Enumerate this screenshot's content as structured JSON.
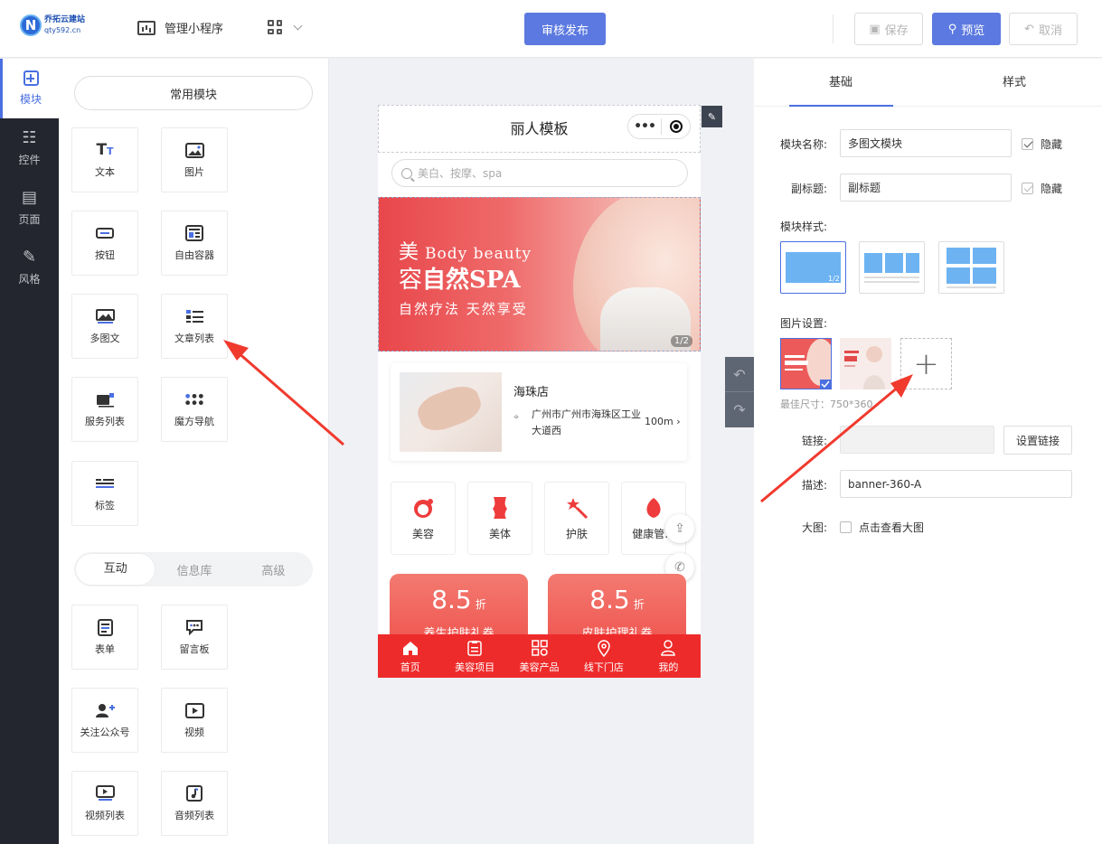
{
  "brand": {
    "line1": "乔拓云建站",
    "line2": "qty592.cn"
  },
  "topbar": {
    "manage_label": "管理小程序",
    "publish_label": "审核发布",
    "save_label": "保存",
    "preview_label": "预览",
    "cancel_label": "取消"
  },
  "leftnav": [
    {
      "label": "模块",
      "icon": "plus-square-icon",
      "active": true
    },
    {
      "label": "控件",
      "icon": "sliders-icon"
    },
    {
      "label": "页面",
      "icon": "pages-icon"
    },
    {
      "label": "风格",
      "icon": "magic-wand-icon"
    }
  ],
  "modules": {
    "common_label": "常用模块",
    "items": [
      "文本",
      "图片",
      "按钮",
      "自由容器",
      "多图文",
      "文章列表",
      "服务列表",
      "魔方导航",
      "标签"
    ],
    "tabs": [
      "互动",
      "信息库",
      "高级"
    ],
    "interactive": [
      "表单",
      "留言板",
      "关注公众号",
      "视频",
      "视频列表",
      "音频列表"
    ]
  },
  "phone": {
    "title": "丽人模板",
    "search_placeholder": "美白、按摩、spa",
    "banner": {
      "line1_a": "美",
      "line1_b": "Body beauty",
      "line2_a": "容",
      "line2_b": "自然SPA",
      "line3": "自然疗法 天然享受",
      "pager": "1/2"
    },
    "store": {
      "name": "海珠店",
      "address": "广州市广州市海珠区工业大道西",
      "distance": "100m"
    },
    "categories": [
      "美容",
      "美体",
      "护肤",
      "健康管..."
    ],
    "coupons": [
      {
        "value": "8.5",
        "unit": "折",
        "desc": "养生护肤礼券"
      },
      {
        "value": "8.5",
        "unit": "折",
        "desc": "皮肤护理礼券"
      }
    ],
    "tabbar": [
      "首页",
      "美容项目",
      "美容产品",
      "线下门店",
      "我的"
    ]
  },
  "panel": {
    "tabs": [
      "基础",
      "样式"
    ],
    "name_label": "模块名称:",
    "name_value": "多图文模块",
    "hide_label": "隐藏",
    "subtitle_label": "副标题:",
    "subtitle_value": "副标题",
    "style_label": "模块样式:",
    "style_badge": "1/2",
    "image_label": "图片设置:",
    "size_hint": "最佳尺寸：750*360",
    "link_label": "链接:",
    "link_value": "",
    "link_button": "设置链接",
    "desc_label": "描述:",
    "desc_value": "banner-360-A",
    "bigimg_label": "大图:",
    "bigimg_check": "点击查看大图"
  },
  "colors": {
    "accent": "#5b79e0",
    "phone_red": "#ee2b2b",
    "nav_dark": "#23262e"
  }
}
